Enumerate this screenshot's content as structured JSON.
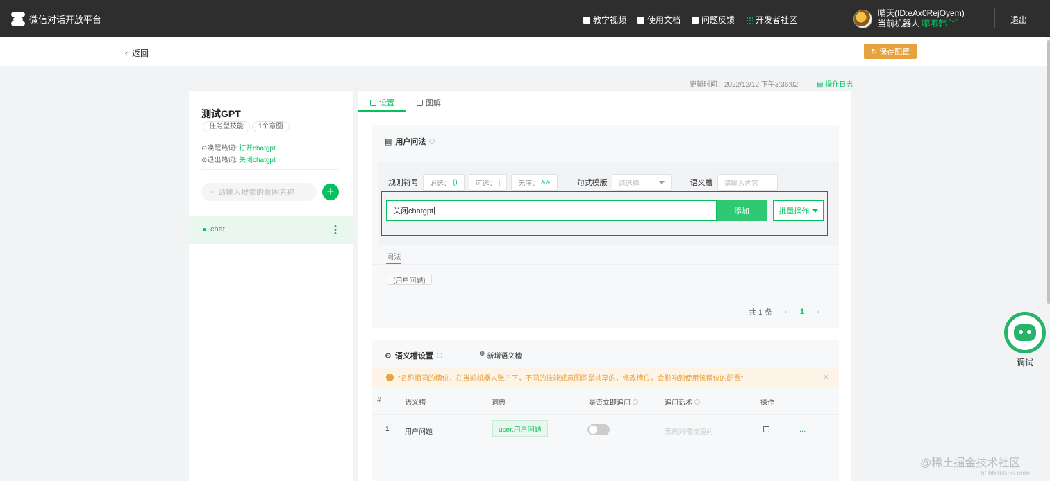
{
  "header": {
    "brand": "微信对话开放平台",
    "nav": [
      {
        "label": "教学视频",
        "icon": "video-icon"
      },
      {
        "label": "使用文档",
        "icon": "doc-icon"
      },
      {
        "label": "问题反馈",
        "icon": "feedback-icon"
      },
      {
        "label": "开发者社区",
        "icon": "grid-icon"
      }
    ],
    "user_name": "晴天(ID:eAx0RejOyem)",
    "robot_prefix": "当前机器人",
    "robot_name": "嘟嘟韩",
    "logout": "退出"
  },
  "subheader": {
    "back": "返回",
    "save": "保存配置"
  },
  "meta": {
    "update_time": "更新时间：2022/12/12 下午3:36:02",
    "oplog": "操作日志"
  },
  "sidebar": {
    "title": "测试GPT",
    "tags": [
      "任务型技能",
      "1个意图"
    ],
    "wake_label": "唤醒热词:",
    "wake_value": "打开chatgpt",
    "exit_label": "退出热词:",
    "exit_value": "关闭chatgpt",
    "search_placeholder": "请输入搜索的意图名称",
    "add": "+",
    "intents": [
      {
        "label": "chat"
      }
    ]
  },
  "main": {
    "tabs": [
      {
        "label": "设置",
        "active": true
      },
      {
        "label": "图解",
        "active": false
      }
    ],
    "user_questions": {
      "title": "用户问法",
      "rule_label": "规则符号",
      "rules": [
        {
          "label": "必选：",
          "sym": "()"
        },
        {
          "label": "可选：",
          "sym": "|"
        },
        {
          "label": "无序：",
          "sym": "&&"
        }
      ],
      "template_label": "句式模版",
      "template_placeholder": "请选择",
      "slot_label": "语义槽",
      "slot_placeholder": "请输入内容",
      "input_value": "关闭chatgpt",
      "add_button": "添加",
      "batch_button": "批量操作",
      "list_tab": "问法",
      "items": [
        "{用户问题}"
      ],
      "pager": {
        "total": "共 1 条",
        "current": "1"
      }
    },
    "slots": {
      "title": "语义槽设置",
      "new_slot": "新增语义槽",
      "warning": "\"名称相同的槽位，在当前机器人账户下，不同的技能或意图间是共享的，修改槽位，会影响到使用该槽位的配置\"",
      "columns": [
        "#",
        "语义槽",
        "词典",
        "是否立即追问",
        "追问话术",
        "操作"
      ],
      "rows": [
        {
          "index": "1",
          "name": "用户问题",
          "dict": "user.用户问题",
          "ask_now": false,
          "prompt": "无需对槽位追问"
        }
      ]
    }
  },
  "debug": {
    "label": "调试"
  },
  "watermark": {
    "text": "@稀土掘金技术社区",
    "sub": "ht.bbs6666.com"
  },
  "colors": {
    "primary": "#07c160",
    "warning": "#e6a23c",
    "highlight": "#e02020",
    "topbar": "#2e2e2e"
  }
}
